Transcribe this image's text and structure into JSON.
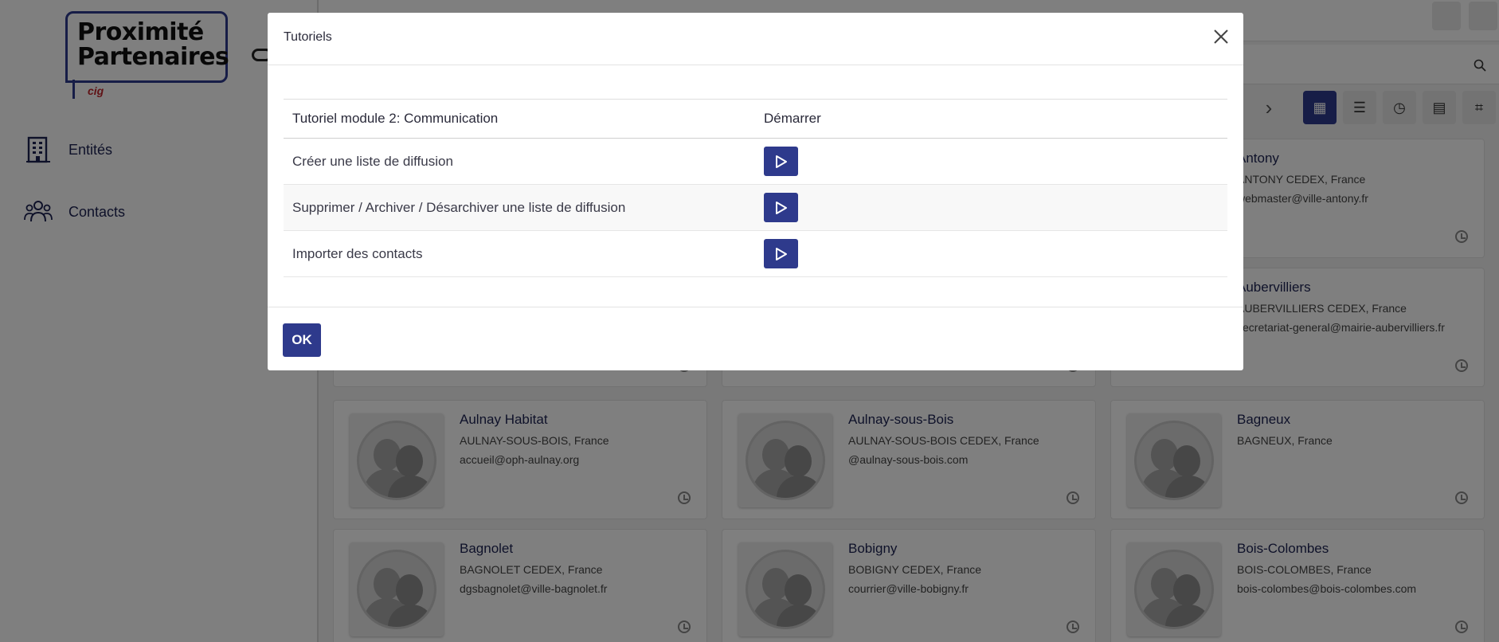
{
  "brand": {
    "line1": "Proximité",
    "line2": "Partenaires",
    "sub": "cig"
  },
  "sidebar": {
    "items": [
      {
        "label": "Entités",
        "icon": "building-icon"
      },
      {
        "label": "Contacts",
        "icon": "users-icon"
      }
    ]
  },
  "cards": [
    {
      "name": "Antony",
      "city": "ANTONY CEDEX, France",
      "email": "webmaster@ville-antony.fr"
    },
    {
      "name": "Aubervilliers",
      "city": "AUBERVILLIERS CEDEX, France",
      "email": "secretariat-general@mairie-aubervilliers.fr"
    },
    {
      "name": "Aulnay Habitat",
      "city": "AULNAY-SOUS-BOIS, France",
      "email": "accueil@oph-aulnay.org"
    },
    {
      "name": "Aulnay-sous-Bois",
      "city": "AULNAY-SOUS-BOIS CEDEX, France",
      "email": "@aulnay-sous-bois.com"
    },
    {
      "name": "Bagneux",
      "city": "BAGNEUX, France",
      "email": ""
    },
    {
      "name": "Bagnolet",
      "city": "BAGNOLET CEDEX, France",
      "email": "dgsbagnolet@ville-bagnolet.fr"
    },
    {
      "name": "Bobigny",
      "city": "BOBIGNY CEDEX, France",
      "email": "courrier@ville-bobigny.fr"
    },
    {
      "name": "Bois-Colombes",
      "city": "BOIS-COLOMBES, France",
      "email": "bois-colombes@bois-colombes.com"
    }
  ],
  "modal": {
    "title": "Tutoriels",
    "table": {
      "header": [
        "Tutoriel module 2: Communication",
        "Démarrer"
      ],
      "rows": [
        {
          "label": "Créer une liste de diffusion"
        },
        {
          "label": "Supprimer / Archiver / Désarchiver une liste de diffusion"
        },
        {
          "label": "Importer des contacts"
        }
      ]
    },
    "ok_label": "OK"
  },
  "colors": {
    "primary": "#2e3a8c",
    "overlay": "rgba(0,0,0,0.5)"
  }
}
